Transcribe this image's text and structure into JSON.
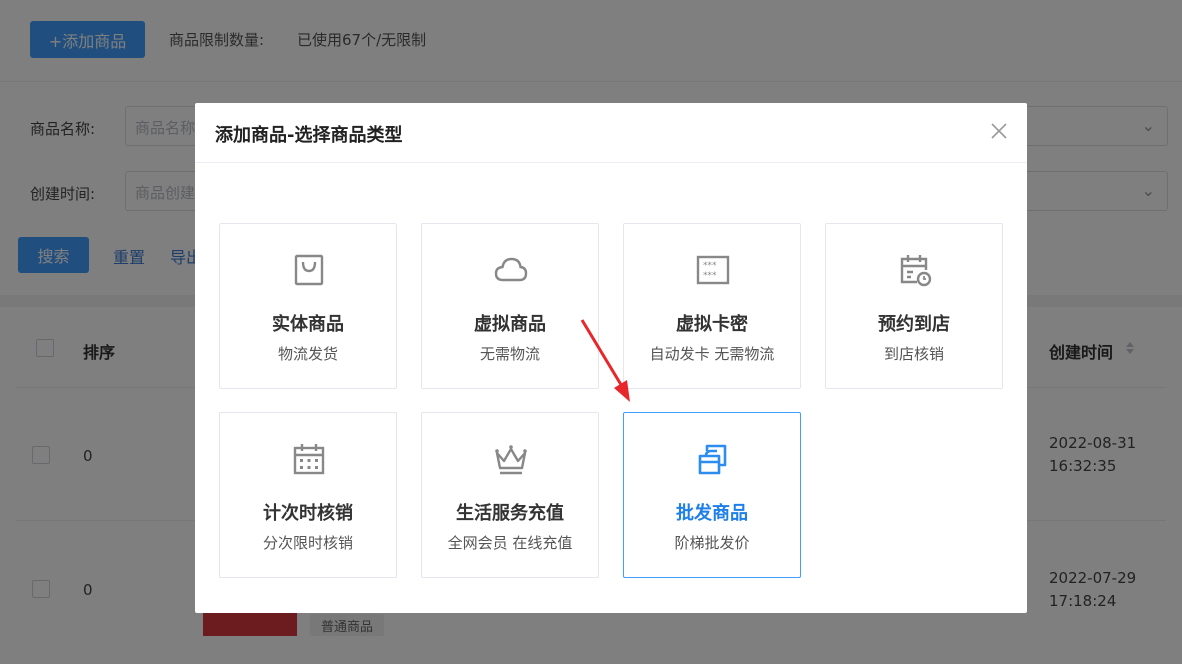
{
  "toolbar": {
    "add_button": "+添加商品",
    "limit_label": "商品限制数量:",
    "limit_value": "已使用67个/无限制"
  },
  "filters": {
    "name_label": "商品名称:",
    "name_placeholder": "商品名称",
    "created_label": "创建时间:",
    "created_placeholder": "商品创建",
    "search_button": "搜索",
    "reset_button": "重置",
    "export_button": "导出"
  },
  "table": {
    "col_sort": "排序",
    "col_created": "创建时间",
    "rows": [
      {
        "sort": "0",
        "date": "2022-08-31",
        "time": "16:32:35"
      },
      {
        "sort": "0",
        "date": "2022-07-29",
        "time": "17:18:24",
        "tag": "普通商品"
      }
    ]
  },
  "dialog": {
    "title": "添加商品-选择商品类型",
    "cards": [
      {
        "title": "实体商品",
        "subtitle": "物流发货",
        "icon": "shopping-bag-icon"
      },
      {
        "title": "虚拟商品",
        "subtitle": "无需物流",
        "icon": "cloud-icon"
      },
      {
        "title": "虚拟卡密",
        "subtitle": "自动发卡 无需物流",
        "icon": "card-code-icon"
      },
      {
        "title": "预约到店",
        "subtitle": "到店核销",
        "icon": "calendar-clock-icon"
      },
      {
        "title": "计次时核销",
        "subtitle": "分次限时核销",
        "icon": "calendar-icon"
      },
      {
        "title": "生活服务充值",
        "subtitle": "全网会员 在线充值",
        "icon": "crown-icon"
      },
      {
        "title": "批发商品",
        "subtitle": "阶梯批发价",
        "icon": "wholesale-box-icon",
        "selected": true
      }
    ]
  },
  "colors": {
    "primary": "#409eff",
    "selected_text": "#1f7fe8",
    "arrow": "#e8272c"
  }
}
